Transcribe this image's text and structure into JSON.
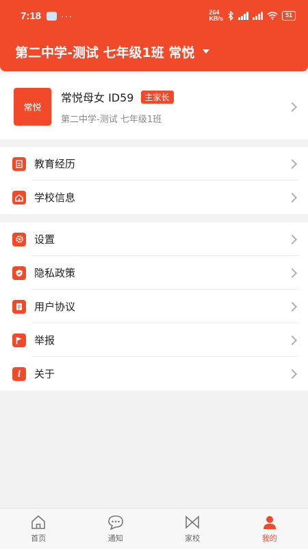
{
  "status_bar": {
    "time": "7:18",
    "more": "···",
    "net_speed_value": "264",
    "net_speed_unit": "KB/s",
    "battery": "51"
  },
  "header": {
    "title": "第二中学-测试 七年级1班 常悦"
  },
  "profile": {
    "avatar_text": "常悦",
    "name": "常悦母女 ID59",
    "badge": "主家长",
    "school": "第二中学-测试  七年级1班"
  },
  "menu_group_1": [
    {
      "label": "教育经历",
      "icon": "education-icon"
    },
    {
      "label": "学校信息",
      "icon": "school-icon"
    }
  ],
  "menu_group_2": [
    {
      "label": "设置",
      "icon": "gear-icon"
    },
    {
      "label": "隐私政策",
      "icon": "shield-icon"
    },
    {
      "label": "用户协议",
      "icon": "document-icon"
    },
    {
      "label": "举报",
      "icon": "flag-icon"
    },
    {
      "label": "关于",
      "icon": "info-icon"
    }
  ],
  "tabs": [
    {
      "label": "首页",
      "icon": "home-icon"
    },
    {
      "label": "通知",
      "icon": "message-icon"
    },
    {
      "label": "家校",
      "icon": "home-school-icon"
    },
    {
      "label": "我的",
      "icon": "person-icon",
      "active": true
    }
  ],
  "colors": {
    "accent": "#f14a2b",
    "background": "#f2f2f2"
  }
}
